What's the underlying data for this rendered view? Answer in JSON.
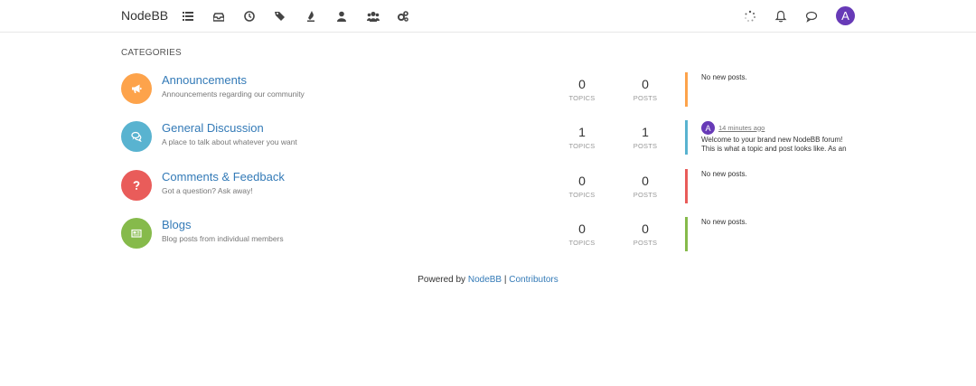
{
  "navbar": {
    "brand": "NodeBB",
    "icons": [
      "list-icon",
      "inbox-icon",
      "clock-icon",
      "tags-icon",
      "trophy-icon",
      "user-icon",
      "users-icon",
      "cogs-icon"
    ],
    "right_icons": [
      "spinner-icon",
      "bell-icon",
      "chat-icon"
    ],
    "avatar_letter": "A",
    "avatar_color": "#673ab7"
  },
  "section_title": "CATEGORIES",
  "categories": [
    {
      "title": "Announcements",
      "description": "Announcements regarding our community",
      "icon": "bullhorn-icon",
      "color": "#fda34b",
      "topics": "0",
      "topics_label": "TOPICS",
      "posts": "0",
      "posts_label": "POSTS",
      "teaser": "No new posts."
    },
    {
      "title": "General Discussion",
      "description": "A place to talk about whatever you want",
      "icon": "comments-icon",
      "color": "#59b3d0",
      "topics": "1",
      "topics_label": "TOPICS",
      "posts": "1",
      "posts_label": "POSTS",
      "teaser_avatar": "A",
      "teaser_time": "14 minutes ago",
      "teaser_line1": "Welcome to your brand new NodeBB forum!",
      "teaser_line2": "This is what a topic and post looks like. As an"
    },
    {
      "title": "Comments & Feedback",
      "description": "Got a question? Ask away!",
      "icon": "question-icon",
      "color": "#e95c5a",
      "topics": "0",
      "topics_label": "TOPICS",
      "posts": "0",
      "posts_label": "POSTS",
      "teaser": "No new posts."
    },
    {
      "title": "Blogs",
      "description": "Blog posts from individual members",
      "icon": "newspaper-icon",
      "color": "#86ba4b",
      "topics": "0",
      "topics_label": "TOPICS",
      "posts": "0",
      "posts_label": "POSTS",
      "teaser": "No new posts."
    }
  ],
  "footer": {
    "prefix": "Powered by",
    "nodebb_link": "NodeBB",
    "separator": "|",
    "contributors_link": "Contributors"
  }
}
